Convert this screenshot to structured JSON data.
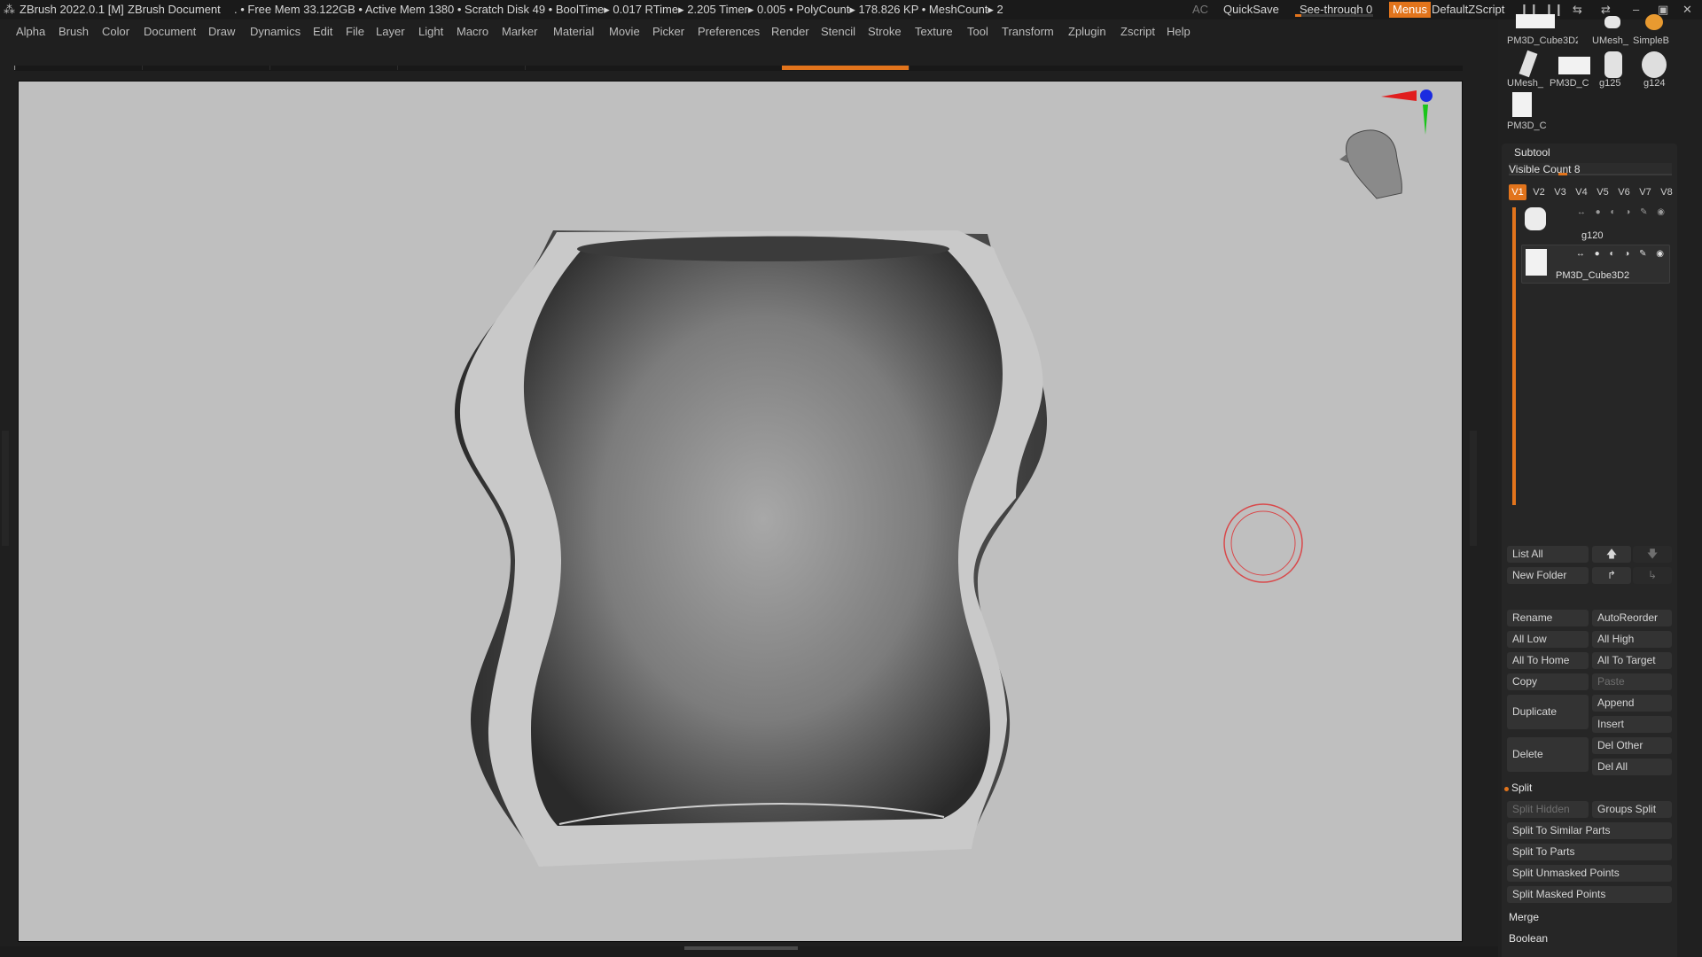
{
  "titlebar": {
    "app_title": "ZBrush 2022.0.1 [M]",
    "document": "ZBrush Document",
    "stats": ". • Free Mem 33.122GB • Active Mem 1380 • Scratch Disk 49 •  BoolTime▸ 0.017 RTime▸ 2.205 Timer▸ 0.005 • PolyCount▸ 178.826 KP  • MeshCount▸ 2",
    "ac": "AC",
    "quicksave": "QuickSave",
    "see_through_label": "See-through",
    "see_through_value": "0",
    "see_through_level": 0.08,
    "menus": "Menus",
    "default_zscript": "DefaultZScript"
  },
  "menubar": {
    "items": [
      "Alpha",
      "Brush",
      "Color",
      "Document",
      "Draw",
      "Dynamics",
      "Edit",
      "File",
      "Layer",
      "Light",
      "Macro",
      "Marker",
      "Material",
      "Movie",
      "Picker",
      "Preferences",
      "Render",
      "Stencil",
      "Stroke",
      "Texture",
      "Tool",
      "Transform",
      "Zplugin",
      "Zscript",
      "Help"
    ]
  },
  "tool_thumbs": [
    {
      "label": "PM3D_Cube3D2"
    },
    {
      "label": "UMesh_"
    },
    {
      "label": "SimpleB"
    },
    {
      "label": "UMesh_"
    },
    {
      "label": "PM3D_C"
    },
    {
      "label": "g125"
    },
    {
      "label": "g124"
    },
    {
      "label": "PM3D_C"
    }
  ],
  "subtool": {
    "title": "Subtool",
    "visible_count_label": "Visible Count 8",
    "visible_count_level": 0.1,
    "tabs": [
      "V1",
      "V2",
      "V3",
      "V4",
      "V5",
      "V6",
      "V7",
      "V8"
    ],
    "active_tab": "V1",
    "items": [
      {
        "name": "g120"
      },
      {
        "name": "PM3D_Cube3D2"
      }
    ],
    "list_all": "List All",
    "new_folder": "New Folder",
    "rename": "Rename",
    "autoreorder": "AutoReorder",
    "all_low": "All Low",
    "all_high": "All High",
    "all_to_home": "All To Home",
    "all_to_target": "All To Target",
    "copy": "Copy",
    "paste": "Paste",
    "duplicate": "Duplicate",
    "append": "Append",
    "insert": "Insert",
    "delete": "Delete",
    "del_other": "Del Other",
    "del_all": "Del All",
    "split_section": "Split",
    "split_hidden": "Split Hidden",
    "groups_split": "Groups Split",
    "split_similar": "Split To Similar Parts",
    "split_parts": "Split To Parts",
    "split_unmasked": "Split Unmasked Points",
    "split_masked": "Split Masked Points",
    "merge_section": "Merge",
    "boolean_section": "Boolean"
  },
  "colors": {
    "accent": "#e2741c",
    "canvas_bg": "#bfbfbf",
    "panel_bg": "#202020",
    "brush_cursor": "#d9484a"
  }
}
